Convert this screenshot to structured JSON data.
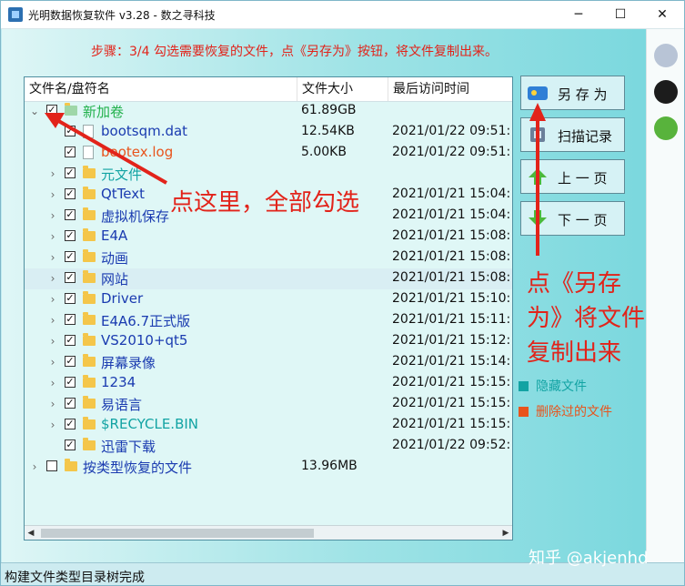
{
  "window": {
    "title": "光明数据恢复软件 v3.28 - 数之寻科技",
    "minimize": "─",
    "maximize": "☐",
    "close": "✕"
  },
  "step_text": "步骤：3/4 勾选需要恢复的文件，点《另存为》按钮，将文件复制出来。",
  "columns": {
    "name": "文件名/盘符名",
    "size": "文件大小",
    "time": "最后访问时间"
  },
  "rows": [
    {
      "name": "新加卷",
      "size": "61.89GB",
      "time": "",
      "expander": "⌄",
      "checked": true,
      "icon": "drive-icon",
      "color": "#22b14c"
    },
    {
      "name": "bootsqm.dat",
      "size": "12.54KB",
      "time": "2021/01/22 09:51:",
      "expander": "",
      "checked": true,
      "icon": "file-icon",
      "color": "#1a3bb0"
    },
    {
      "name": "bootex.log",
      "size": "5.00KB",
      "time": "2021/01/22 09:51:",
      "expander": "",
      "checked": true,
      "icon": "file-icon",
      "color": "#e8541c"
    },
    {
      "name": "元文件",
      "size": "",
      "time": "",
      "expander": "›",
      "checked": true,
      "icon": "folder-icon",
      "color": "#12a3a3"
    },
    {
      "name": "QtText",
      "size": "",
      "time": "2021/01/21 15:04:",
      "expander": "›",
      "checked": true,
      "icon": "folder-icon",
      "color": "#1a3bb0"
    },
    {
      "name": "虚拟机保存",
      "size": "",
      "time": "2021/01/21 15:04:",
      "expander": "›",
      "checked": true,
      "icon": "folder-icon",
      "color": "#1a3bb0"
    },
    {
      "name": "E4A",
      "size": "",
      "time": "2021/01/21 15:08:",
      "expander": "›",
      "checked": true,
      "icon": "folder-icon",
      "color": "#1a3bb0"
    },
    {
      "name": "动画",
      "size": "",
      "time": "2021/01/21 15:08:",
      "expander": "›",
      "checked": true,
      "icon": "folder-icon",
      "color": "#1a3bb0"
    },
    {
      "name": "网站",
      "size": "",
      "time": "2021/01/21 15:08:",
      "expander": "›",
      "checked": true,
      "icon": "folder-icon",
      "color": "#1a3bb0",
      "selected": true
    },
    {
      "name": "Driver",
      "size": "",
      "time": "2021/01/21 15:10:",
      "expander": "›",
      "checked": true,
      "icon": "folder-icon",
      "color": "#1a3bb0"
    },
    {
      "name": "E4A6.7正式版",
      "size": "",
      "time": "2021/01/21 15:11:",
      "expander": "›",
      "checked": true,
      "icon": "folder-icon",
      "color": "#1a3bb0"
    },
    {
      "name": "VS2010+qt5",
      "size": "",
      "time": "2021/01/21 15:12:",
      "expander": "›",
      "checked": true,
      "icon": "folder-icon",
      "color": "#1a3bb0"
    },
    {
      "name": "屏幕录像",
      "size": "",
      "time": "2021/01/21 15:14:",
      "expander": "›",
      "checked": true,
      "icon": "folder-icon",
      "color": "#1a3bb0"
    },
    {
      "name": "1234",
      "size": "",
      "time": "2021/01/21 15:15:",
      "expander": "›",
      "checked": true,
      "icon": "folder-icon",
      "color": "#1a3bb0"
    },
    {
      "name": "易语言",
      "size": "",
      "time": "2021/01/21 15:15:",
      "expander": "›",
      "checked": true,
      "icon": "folder-icon",
      "color": "#1a3bb0"
    },
    {
      "name": "$RECYCLE.BIN",
      "size": "",
      "time": "2021/01/21 15:15:",
      "expander": "›",
      "checked": true,
      "icon": "folder-icon",
      "color": "#12a3a3"
    },
    {
      "name": "迅雷下载",
      "size": "",
      "time": "2021/01/22 09:52:",
      "expander": "",
      "checked": true,
      "icon": "folder-icon",
      "color": "#1a3bb0"
    },
    {
      "name": "按类型恢复的文件",
      "size": "13.96MB",
      "time": "",
      "expander": "›",
      "checked": false,
      "icon": "folder-icon",
      "color": "#1a3bb0"
    }
  ],
  "scroll": {
    "left": "◀",
    "right": "▶"
  },
  "buttons": {
    "save_as": "另 存 为",
    "scan_record": "扫描记录",
    "prev_page": "上 一 页",
    "next_page": "下 一 页"
  },
  "legend": {
    "hidden": {
      "label": "隐藏文件",
      "color": "#12a3a3"
    },
    "deleted": {
      "label": "删除过的文件",
      "color": "#e8541c"
    }
  },
  "status": "构建文件类型目录树完成",
  "watermark": "知乎 @akjenhd",
  "annotations": {
    "select_all": "点这里，全部勾选",
    "save_line1": "点《另存",
    "save_line2": "为》将文件",
    "save_line3": "复制出来"
  },
  "colors": {
    "annotation": "#e2231a",
    "window_bg": "#bfeaf0"
  }
}
